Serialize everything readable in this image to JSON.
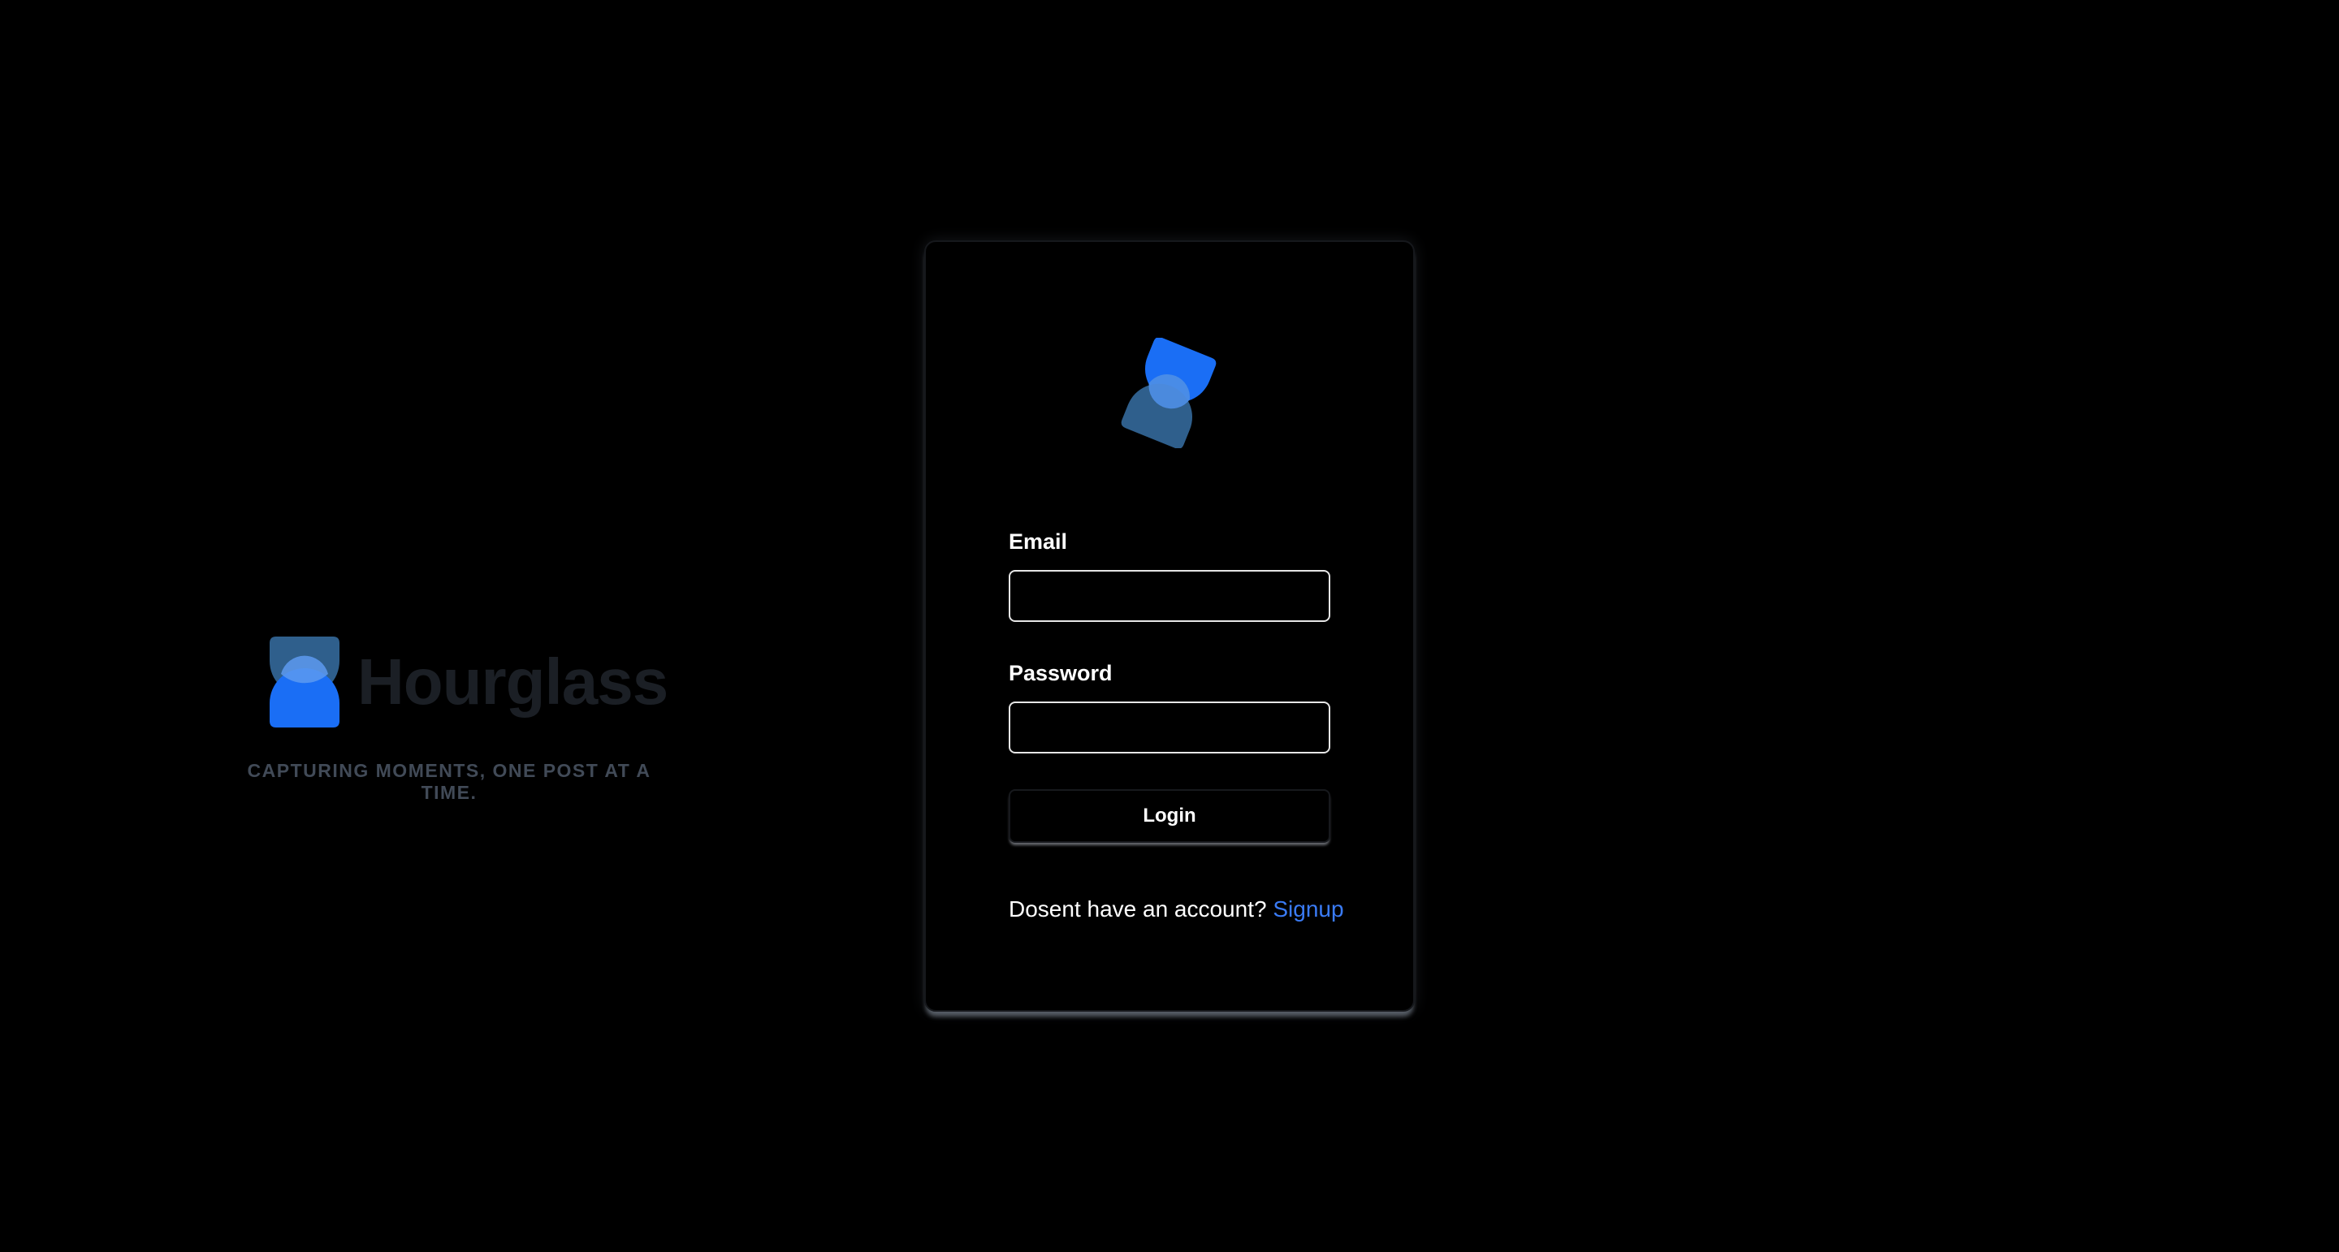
{
  "brand": {
    "name": "Hourglass",
    "tagline": "CAPTURING MOMENTS, ONE POST AT A TIME.",
    "logo_icon": "hourglass-icon"
  },
  "login_card": {
    "logo_icon": "hourglass-icon",
    "email": {
      "label": "Email",
      "value": "",
      "placeholder": ""
    },
    "password": {
      "label": "Password",
      "value": "",
      "placeholder": ""
    },
    "login_label": "Login",
    "signup_prompt": "Dosent have an account?",
    "signup_link": "Signup"
  },
  "colors": {
    "background": "#000000",
    "accent": "#1a6ef5",
    "accent_muted": "#3a6b9c",
    "link": "#3a7bf5",
    "brand_text": "#1b1f25",
    "tagline": "#414a57"
  }
}
